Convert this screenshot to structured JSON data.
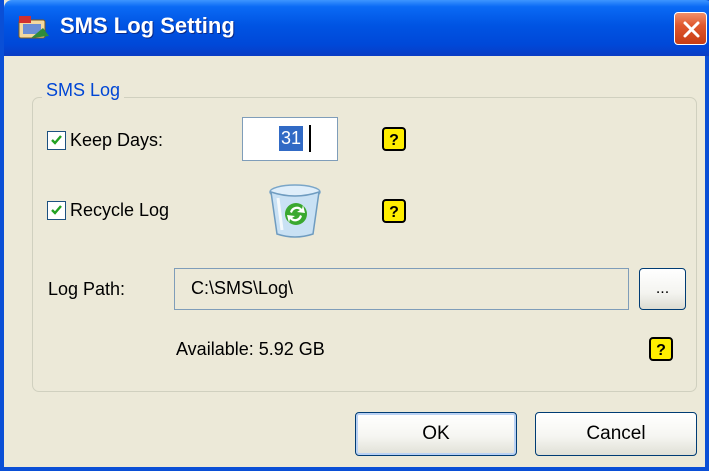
{
  "window": {
    "title": "SMS Log Setting"
  },
  "group": {
    "label": "SMS Log"
  },
  "keep_days": {
    "checked": true,
    "label": "Keep Days:",
    "value": "31"
  },
  "recycle_log": {
    "checked": true,
    "label": "Recycle Log"
  },
  "log_path": {
    "label": "Log Path:",
    "value": "C:\\SMS\\Log\\",
    "browse_label": "..."
  },
  "available": {
    "text": "Available: 5.92 GB"
  },
  "buttons": {
    "ok": "OK",
    "cancel": "Cancel"
  },
  "icons": {
    "title": "sms-app-icon",
    "close": "close-icon",
    "help": "help-icon",
    "recycle": "recycle-bin-icon"
  },
  "colors": {
    "titlebar": "#0054e3",
    "group_label": "#0046d5",
    "selection": "#316ac5",
    "help_badge": "#ffee00",
    "close": "#e0582e"
  }
}
